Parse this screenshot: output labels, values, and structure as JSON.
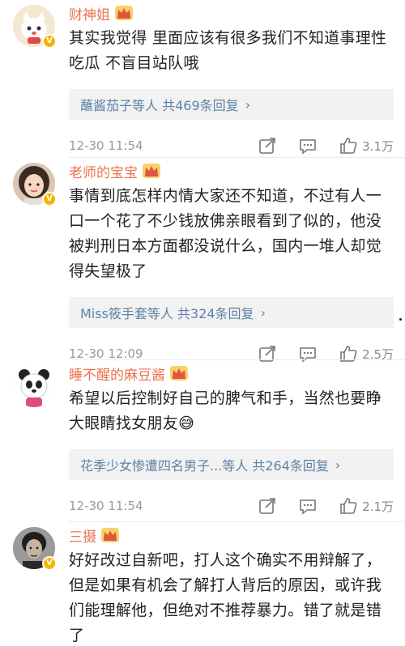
{
  "comments": [
    {
      "username": "财神姐",
      "text": "其实我觉得 里面应该有很多我们不知道事理性吃瓜 不盲目站队哦",
      "replies": "蘸酱茄子等人 共469条回复",
      "time": "12-30 11:54",
      "likes": "3.1万",
      "avatar_icon": "cat-avatar-icon"
    },
    {
      "username": "老师的宝宝",
      "text": "事情到底怎样内情大家还不知道，不过有人一口一个花了不少钱放佛亲眼看到了似的，他没被判刑日本方面都没说什么，国内一堆人却觉得失望极了",
      "replies": "Miss筱手套等人 共324条回复",
      "time": "12-30 12:09",
      "likes": "2.5万",
      "avatar_icon": "girl-avatar-icon"
    },
    {
      "username": "睡不醒的麻豆酱",
      "text": "希望以后控制好自己的脾气和手，当然也要睁大眼睛找女朋友😅",
      "replies": "花季少女惨遭四名男子...等人 共264条回复",
      "time": "12-30 11:54",
      "likes": "2.1万",
      "avatar_icon": "panda-avatar-icon"
    },
    {
      "username": "三摄",
      "text": "好好改过自新吧，打人这个确实不用辩解了，但是如果有机会了解打人背后的原因，或许我们能理解他，但绝对不推荐暴力。错了就是错了",
      "avatar_icon": "man-avatar-icon"
    }
  ],
  "chevron": "›"
}
